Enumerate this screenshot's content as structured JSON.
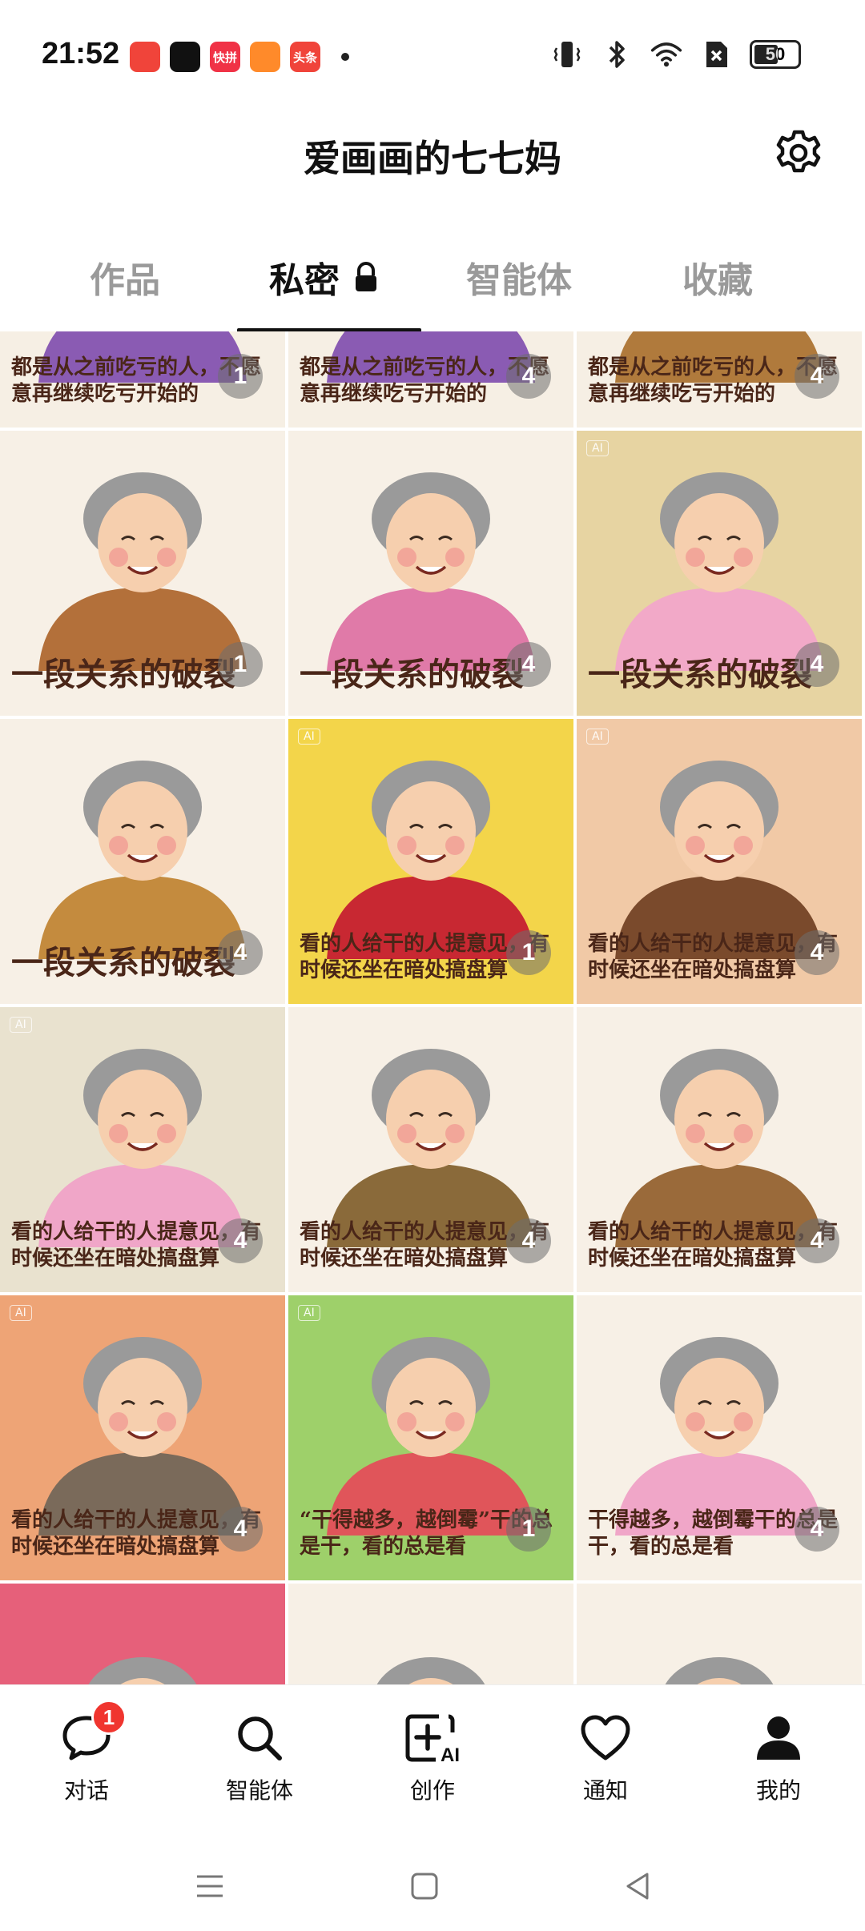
{
  "status_bar": {
    "time": "21:52",
    "apps": [
      {
        "name": "red-envelope-app-icon",
        "label": "",
        "color": "#f0443a"
      },
      {
        "name": "tiktok-app-icon",
        "label": "",
        "color": "#111111"
      },
      {
        "name": "kuaishou-app-icon",
        "label": "快拼",
        "color": "#f03246"
      },
      {
        "name": "video-app-icon",
        "label": "",
        "color": "#ff8a2a"
      },
      {
        "name": "toutiao-app-icon",
        "label": "头条",
        "color": "#f0443a"
      }
    ],
    "battery": "50"
  },
  "header": {
    "title": "爱画画的七七妈"
  },
  "tabs": [
    {
      "label": "作品",
      "active": false
    },
    {
      "label": "私密",
      "active": true
    },
    {
      "label": "智能体",
      "active": false
    },
    {
      "label": "收藏",
      "active": false
    }
  ],
  "grid": {
    "cells": [
      {
        "bg": "#f6efe4",
        "sweater": "#8a5bb3",
        "caption": "都是从之前吃亏的人，不愿意再继续吃亏开始的",
        "size": "small",
        "count": "1",
        "partial": true
      },
      {
        "bg": "#f6efe4",
        "sweater": "#8a5bb3",
        "caption": "都是从之前吃亏的人，不愿意再继续吃亏开始的",
        "size": "small",
        "count": "4",
        "partial": true
      },
      {
        "bg": "#f6efe4",
        "sweater": "#b07a3c",
        "caption": "都是从之前吃亏的人，不愿意再继续吃亏开始的",
        "size": "small",
        "count": "4",
        "partial": true
      },
      {
        "bg": "#f7f0e6",
        "sweater": "#b3703a",
        "caption": "一段关系的破裂",
        "size": "big",
        "count": "1"
      },
      {
        "bg": "#f7f0e6",
        "sweater": "#e07aa8",
        "caption": "一段关系的破裂",
        "size": "big",
        "count": "4"
      },
      {
        "bg": "#e7d4a2",
        "sweater": "#f2a9c8",
        "caption": "一段关系的破裂",
        "size": "big",
        "count": "4"
      },
      {
        "bg": "#f7f0e6",
        "sweater": "#c48b3e",
        "caption": "一段关系的破裂",
        "size": "big",
        "count": "4"
      },
      {
        "bg": "#f3d54a",
        "sweater": "#c82832",
        "caption": "看的人给干的人提意见，有时候还坐在暗处搞盘算",
        "size": "small",
        "count": "1"
      },
      {
        "bg": "#f1c9a6",
        "sweater": "#7a4a2c",
        "caption": "看的人给干的人提意见，有时候还坐在暗处搞盘算",
        "size": "small",
        "count": "4"
      },
      {
        "bg": "#e9e2cf",
        "sweater": "#f0a6c8",
        "caption": "看的人给干的人提意见，有时候还坐在暗处搞盘算",
        "size": "small",
        "count": "4"
      },
      {
        "bg": "#f7f0e6",
        "sweater": "#8a6a3a",
        "caption": "看的人给干的人提意见，有时候还坐在暗处搞盘算",
        "size": "small",
        "count": "4"
      },
      {
        "bg": "#f7f0e6",
        "sweater": "#9a6a3a",
        "caption": "看的人给干的人提意见，有时候还坐在暗处搞盘算",
        "size": "small",
        "count": "4"
      },
      {
        "bg": "#eea476",
        "sweater": "#7a6a5a",
        "caption": "看的人给干的人提意见，有时候还坐在暗处搞盘算",
        "size": "small",
        "count": "4"
      },
      {
        "bg": "#9ed06a",
        "sweater": "#e0555a",
        "caption": "“干得越多，越倒霉”干的总是干，看的总是看",
        "size": "small",
        "count": "1"
      },
      {
        "bg": "#f7f0e6",
        "sweater": "#f0a6c8",
        "caption": "干得越多，越倒霉干的总是干，看的总是看",
        "size": "small",
        "count": "4"
      },
      {
        "bg": "#e6607a",
        "sweater": "#cccccc",
        "caption": "",
        "size": "small",
        "count": "",
        "partial": true
      },
      {
        "bg": "#f7f0e6",
        "sweater": "#cccccc",
        "caption": "",
        "size": "small",
        "count": "",
        "partial": true
      },
      {
        "bg": "#f7f0e6",
        "sweater": "#cccccc",
        "caption": "",
        "size": "small",
        "count": "",
        "partial": true
      }
    ]
  },
  "bottom_nav": [
    {
      "label": "对话",
      "icon": "chat-icon",
      "badge": "1"
    },
    {
      "label": "智能体",
      "icon": "search-icon",
      "badge": ""
    },
    {
      "label": "创作",
      "icon": "ai-create-icon",
      "badge": ""
    },
    {
      "label": "通知",
      "icon": "heart-icon",
      "badge": ""
    },
    {
      "label": "我的",
      "icon": "profile-icon",
      "badge": ""
    }
  ]
}
